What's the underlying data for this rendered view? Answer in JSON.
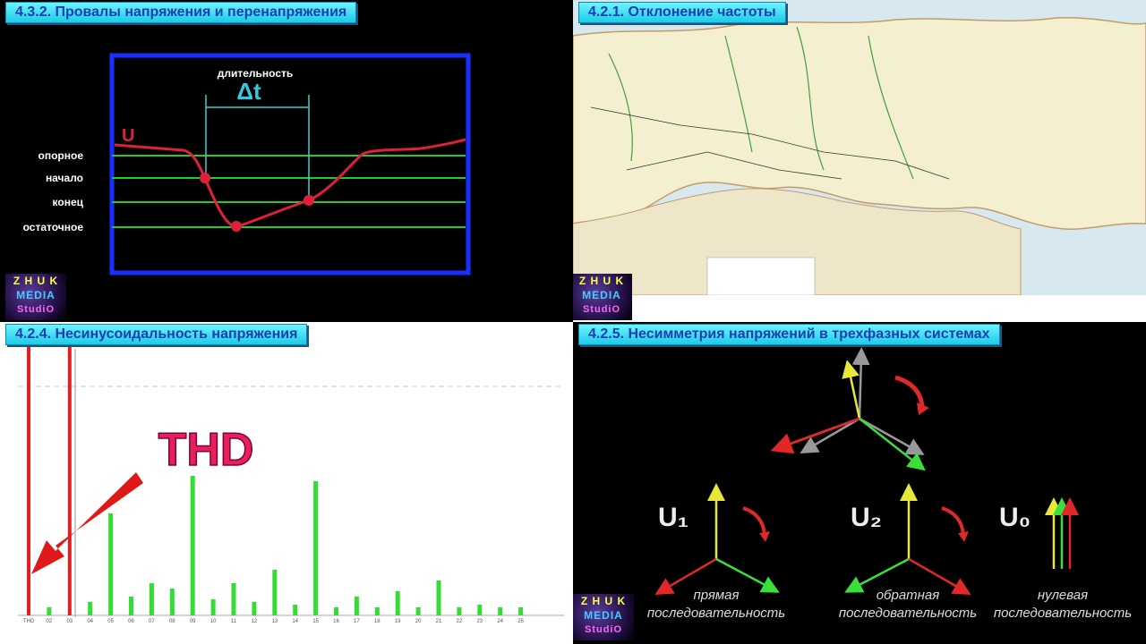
{
  "q1": {
    "title": "4.3.2. Провалы напряжения и перенапряжения",
    "duration_label": "длительность",
    "delta_label": "Δt",
    "u_label": "U",
    "levels": [
      "опорное",
      "начало",
      "конец",
      "остаточное"
    ]
  },
  "q2": {
    "title": "4.2.1. Отклонение частоты"
  },
  "q3": {
    "title": "4.2.4. Несинусоидальность напряжения",
    "thd_label": "THD",
    "chart_data": {
      "type": "bar",
      "categories": [
        "THD",
        "02",
        "03",
        "04",
        "05",
        "06",
        "07",
        "08",
        "09",
        "10",
        "11",
        "12",
        "13",
        "14",
        "15",
        "16",
        "17",
        "18",
        "19",
        "20",
        "21",
        "22",
        "23",
        "24",
        "25"
      ],
      "values": [
        100,
        3,
        100,
        5,
        38,
        7,
        12,
        10,
        52,
        6,
        12,
        5,
        17,
        4,
        50,
        3,
        7,
        3,
        9,
        3,
        13,
        3,
        4,
        3,
        3
      ],
      "ylim": [
        0,
        100
      ],
      "colors": {
        "fundamental": "#e02020",
        "harmonic": "#33dd33"
      }
    }
  },
  "q4": {
    "title": "4.2.5. Несимметрия напряжений в трехфазных системах",
    "u1": "U₁",
    "u2": "U₂",
    "u0": "U₀",
    "u1_caption": [
      "прямая",
      "последовательность"
    ],
    "u2_caption": [
      "обратная",
      "последовательность"
    ],
    "u0_caption": [
      "нулевая",
      "последовательность"
    ]
  },
  "logo": {
    "line1": "Z H U K",
    "line2": "MEDIA",
    "line3": "StudiO"
  }
}
